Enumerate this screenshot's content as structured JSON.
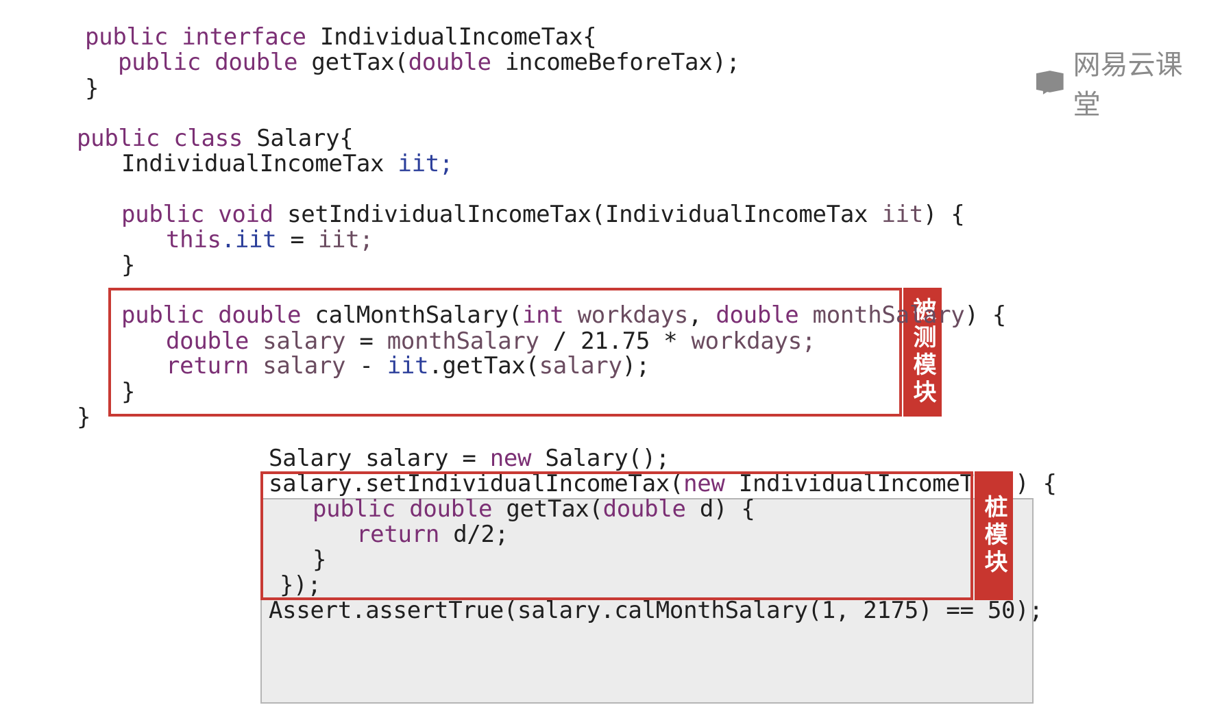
{
  "watermark": {
    "text": "网易云课堂"
  },
  "labels": {
    "module_under_test": "被测模块",
    "stub_module": "桩模块"
  },
  "code": {
    "interface": [
      [
        "public",
        "interface",
        "IndividualIncomeTax{"
      ],
      [
        "public",
        "double",
        "getTax(",
        "double",
        "incomeBeforeTax);"
      ],
      [
        "}"
      ]
    ],
    "class_header": [
      "public",
      "class",
      "Salary{"
    ],
    "field_line": [
      "IndividualIncomeTax",
      "iit;"
    ],
    "setter": [
      "public",
      "void",
      "setIndividualIncomeTax(IndividualIncomeTax",
      "iit",
      ") {"
    ],
    "setter_body": [
      "this",
      ".iit",
      "=",
      "iit;"
    ],
    "setter_close": "}",
    "cal_sig": [
      "public",
      "double",
      "calMonthSalary(",
      "int",
      "workdays",
      ",",
      "double",
      "monthSalary",
      ") {"
    ],
    "cal_l1": [
      "double",
      "salary",
      "=",
      "monthSalary",
      "/ 21.75 *",
      "workdays;"
    ],
    "cal_l2": [
      "return",
      "salary",
      "-",
      "iit",
      ".getTax(",
      "salary",
      ");"
    ],
    "cal_close": "}",
    "class_close": "}"
  },
  "test": {
    "l1": [
      "Salary salary = ",
      "new",
      " Salary();"
    ],
    "l2": [
      "salary.setIndividualIncomeTax(",
      "new",
      " IndividualIncomeTax() {"
    ],
    "l3": [
      "public",
      "double",
      "getTax(",
      "double",
      "d) {"
    ],
    "l4": [
      "return",
      "d/2;"
    ],
    "l5": "}",
    "l6": "});",
    "l7": "Assert.assertTrue(salary.calMonthSalary(1, 2175) == 50);"
  }
}
